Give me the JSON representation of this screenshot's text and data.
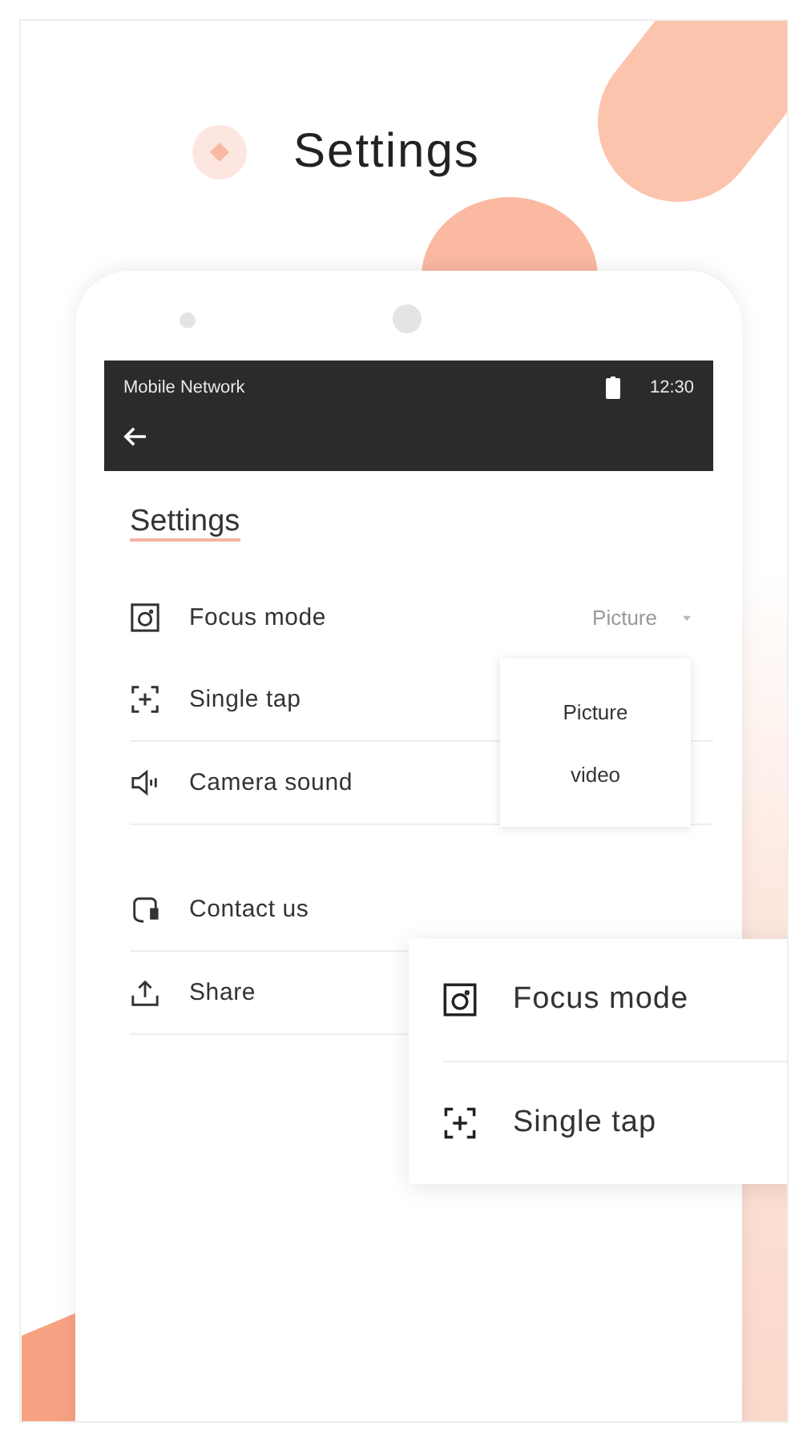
{
  "headline": {
    "title": "Settings"
  },
  "status_bar": {
    "carrier": "Mobile Network",
    "time": "12:30"
  },
  "screen": {
    "title": "Settings"
  },
  "settings_groups": [
    {
      "rows": [
        {
          "label": "Focus mode",
          "kind": "focus",
          "value": "Picture"
        },
        {
          "label": "Single tap",
          "kind": "tap"
        },
        {
          "label": "Camera sound",
          "kind": "sound"
        }
      ]
    },
    {
      "rows": [
        {
          "label": "Contact us",
          "kind": "contact"
        },
        {
          "label": "Share",
          "kind": "share"
        }
      ]
    }
  ],
  "dropdown": {
    "options": [
      {
        "label": "Picture"
      },
      {
        "label": "video"
      }
    ]
  },
  "callout_card": {
    "items": [
      {
        "label": "Focus mode",
        "kind": "focus"
      },
      {
        "label": "Single tap",
        "kind": "tap"
      }
    ]
  }
}
